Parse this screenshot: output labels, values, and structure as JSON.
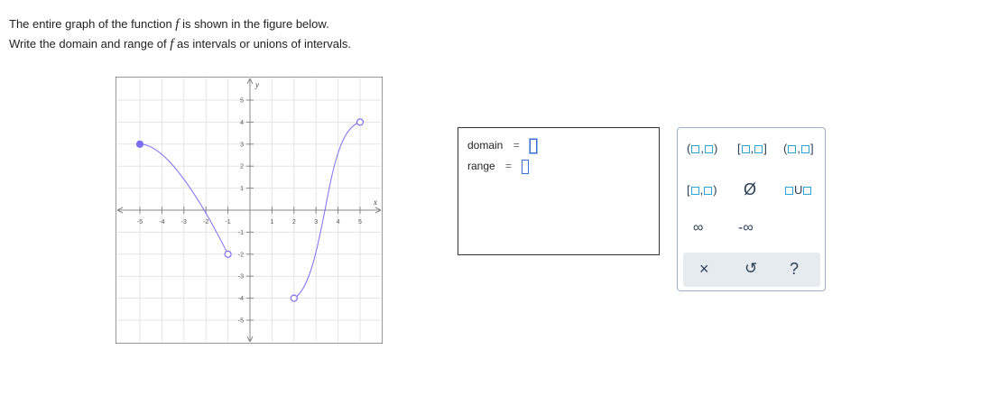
{
  "prompt": {
    "line1_pre": "The entire graph of the function ",
    "line1_var": "f",
    "line1_post": " is shown in the figure below.",
    "line2_pre": "Write the domain and range of ",
    "line2_var": "f",
    "line2_post": " as intervals or unions of intervals."
  },
  "graph": {
    "x_axis_label": "x",
    "y_axis_label": "y",
    "x_ticks": [
      "-5",
      "-4",
      "-3",
      "-2",
      "-1",
      "1",
      "2",
      "3",
      "4",
      "5"
    ],
    "y_ticks": [
      "5",
      "4",
      "3",
      "2",
      "1",
      "-1",
      "-2",
      "-3",
      "-4",
      "-5"
    ],
    "curve_color": "#7b6ef6",
    "segment1": {
      "start": {
        "x": -5,
        "y": 3,
        "endpoint": "closed"
      },
      "end": {
        "x": -1,
        "y": -2,
        "endpoint": "open"
      }
    },
    "segment2": {
      "start": {
        "x": 2,
        "y": -4,
        "endpoint": "open"
      },
      "end": {
        "x": 5,
        "y": 4,
        "endpoint": "open"
      }
    }
  },
  "answer": {
    "domain_label": "domain",
    "range_label": "range",
    "equals": "=",
    "domain_value": "",
    "range_value": ""
  },
  "palette": {
    "open_open": "(□,□)",
    "closed_closed": "[□,□]",
    "open_closed": "(□,□]",
    "closed_open": "[□,□)",
    "empty_set": "Ø",
    "union": "□U□",
    "infinity": "∞",
    "neg_infinity": "-∞",
    "clear_icon": "×",
    "undo_icon": "↺",
    "help_icon": "?"
  }
}
